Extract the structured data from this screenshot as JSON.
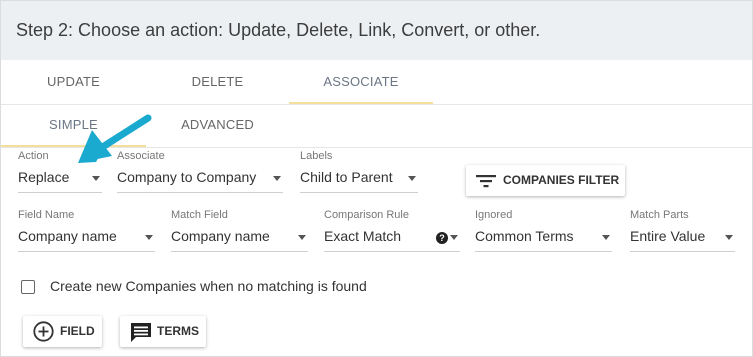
{
  "header": {
    "title": "Step 2: Choose an action: Update, Delete, Link, Convert, or other."
  },
  "tabs": [
    {
      "label": "UPDATE"
    },
    {
      "label": "DELETE"
    },
    {
      "label": "ASSOCIATE",
      "active": true
    }
  ],
  "subtabs": [
    {
      "label": "SIMPLE",
      "active": true
    },
    {
      "label": "ADVANCED"
    }
  ],
  "row1": {
    "action": {
      "label": "Action",
      "value": "Replace"
    },
    "associate": {
      "label": "Associate",
      "value": "Company to Company"
    },
    "labels": {
      "label": "Labels",
      "value": "Child to Parent"
    },
    "filter_button": {
      "label": "COMPANIES FILTER",
      "icon": "filter-icon"
    }
  },
  "row2": {
    "field_name": {
      "label": "Field Name",
      "value": "Company name"
    },
    "match_field": {
      "label": "Match Field",
      "value": "Company name"
    },
    "comparison_rule": {
      "label": "Comparison Rule",
      "value": "Exact Match",
      "help": "?"
    },
    "ignored": {
      "label": "Ignored",
      "value": "Common Terms"
    },
    "match_parts": {
      "label": "Match Parts",
      "value": "Entire Value"
    }
  },
  "create_new": {
    "label": "Create new Companies when no matching is found",
    "checked": false
  },
  "buttons": {
    "field": {
      "label": "FIELD",
      "icon": "plus-circle-icon"
    },
    "terms": {
      "label": "TERMS",
      "icon": "comment-icon"
    }
  },
  "colors": {
    "accent_underline": "#f3de9b",
    "annotation_arrow": "#1aa9cf",
    "header_bg": "#edf0f3"
  }
}
